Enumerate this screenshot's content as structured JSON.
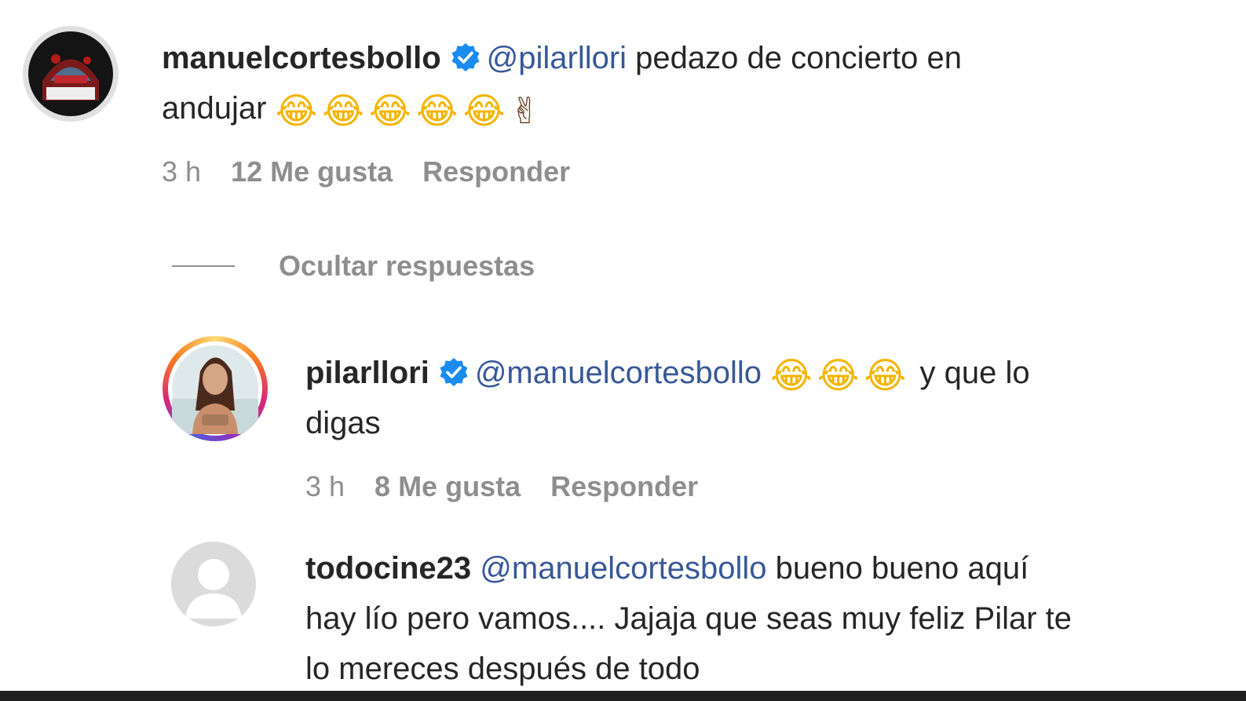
{
  "comments": [
    {
      "username": "manuelcortesbollo",
      "verified": true,
      "mention": "@pilarllori",
      "text_before": "pedazo de concierto en",
      "text_line2": "andujar",
      "emojis": [
        "😂",
        "😂",
        "😂",
        "😂",
        "😂",
        "✌"
      ],
      "time": "3 h",
      "likes": "12 Me gusta",
      "reply": "Responder"
    },
    {
      "username": "pilarllori",
      "verified": true,
      "mention": "@manuelcortesbollo",
      "emojis": [
        "😂",
        "😂",
        "😂"
      ],
      "text_after": "y que lo",
      "text_line2": "digas",
      "time": "3 h",
      "likes": "8 Me gusta",
      "reply": "Responder"
    },
    {
      "username": "todocine23",
      "verified": false,
      "mention": "@manuelcortesbollo",
      "line1": "bueno bueno aquí",
      "line2": "hay lío pero vamos.... Jajaja que seas muy feliz Pilar te",
      "line3": "lo mereces después de todo"
    }
  ],
  "hide_replies": "Ocultar respuestas",
  "colors": {
    "text": "#262626",
    "mention": "#385898",
    "meta": "#8e8e8e",
    "verified": "#1a8cf0"
  },
  "icons": {
    "verified": "verified-badge-icon",
    "default_avatar": "default-avatar-icon"
  }
}
